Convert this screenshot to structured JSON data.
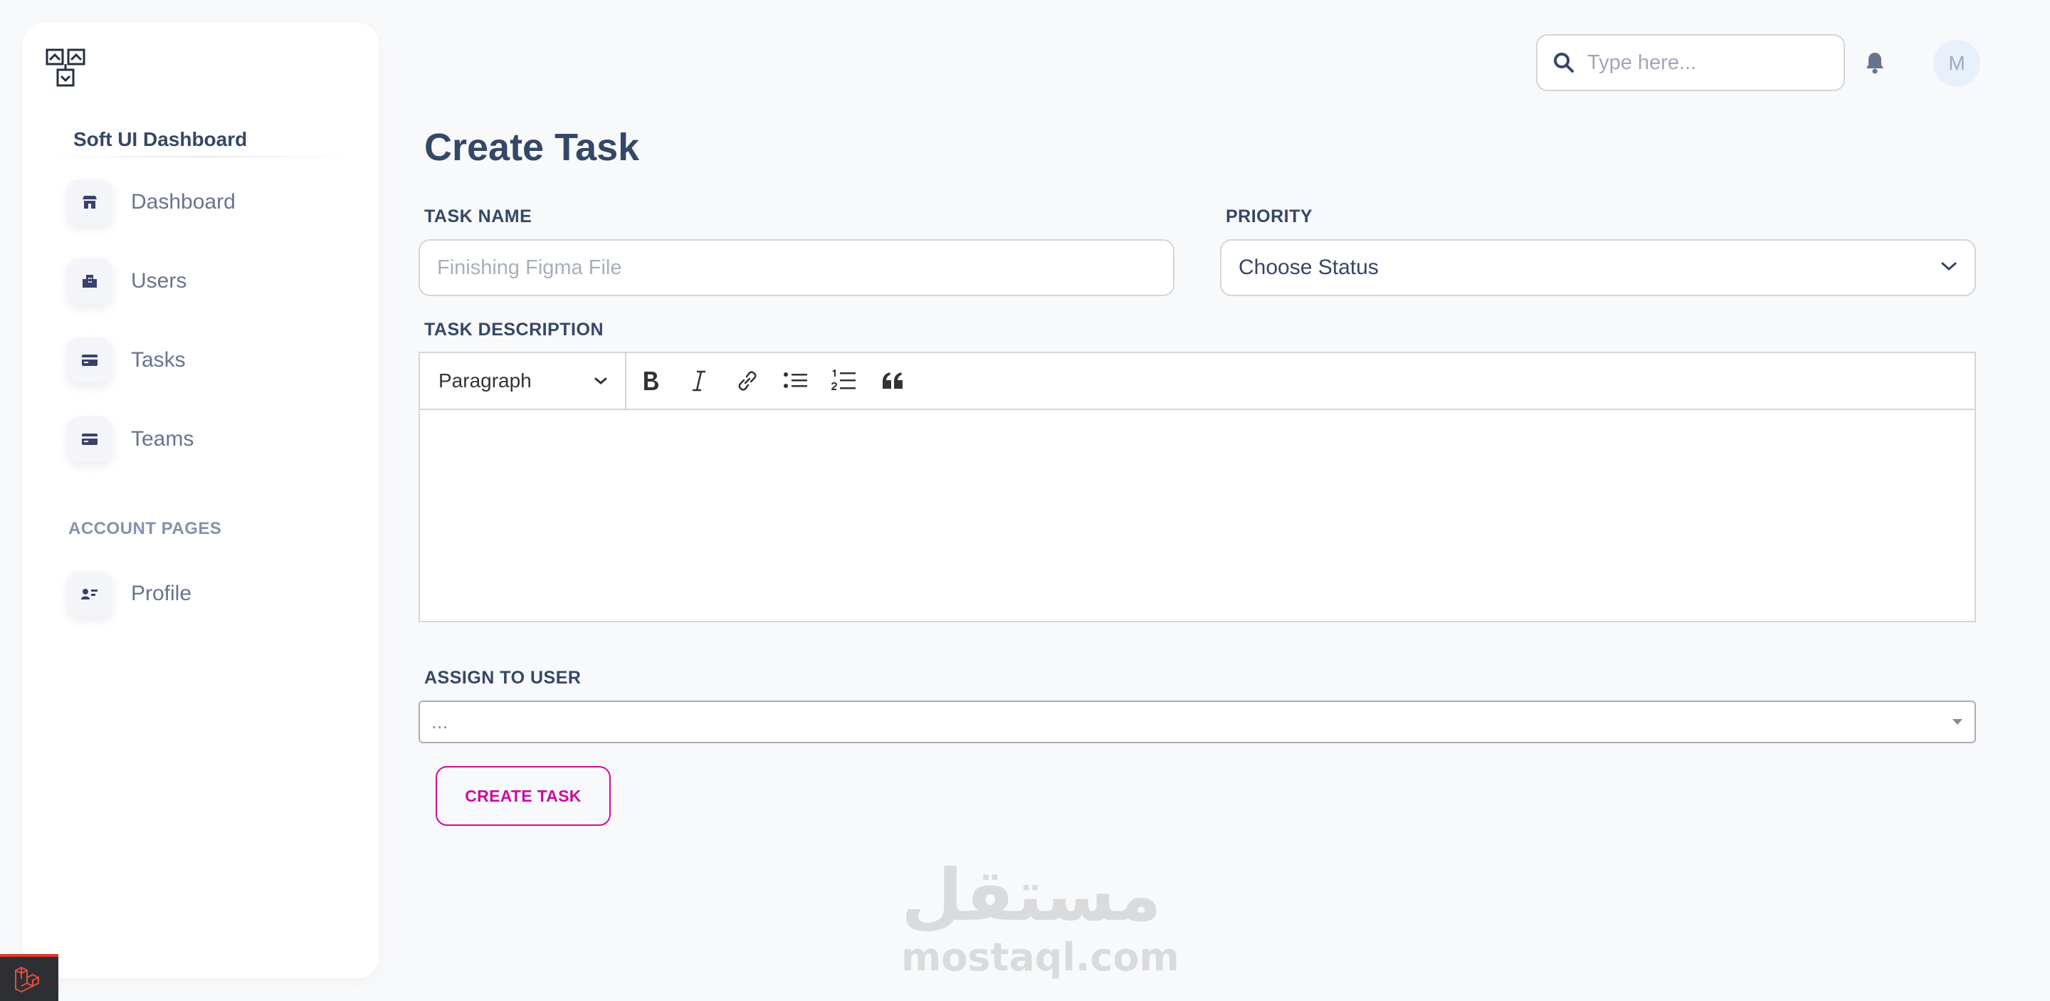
{
  "brand": {
    "name": "Soft UI Dashboard"
  },
  "sidebar": {
    "items": [
      {
        "label": "Dashboard",
        "icon": "shop-icon"
      },
      {
        "label": "Users",
        "icon": "office-icon"
      },
      {
        "label": "Tasks",
        "icon": "credit-card-icon"
      },
      {
        "label": "Teams",
        "icon": "credit-card-icon"
      }
    ],
    "section_title": "ACCOUNT PAGES",
    "account_items": [
      {
        "label": "Profile",
        "icon": "user-card-icon"
      }
    ]
  },
  "topbar": {
    "search_placeholder": "Type here...",
    "avatar_initial": "M"
  },
  "form": {
    "title": "Create Task",
    "task_name_label": "TASK NAME",
    "task_name_placeholder": "Finishing Figma File",
    "priority_label": "PRIORITY",
    "priority_value": "Choose Status",
    "description_label": "TASK DESCRIPTION",
    "editor_paragraph": "Paragraph",
    "assign_label": "ASSIGN TO USER",
    "assign_value": "...",
    "submit_label": "CREATE TASK"
  },
  "watermark": {
    "arabic": "مستقل",
    "latin": "mostaql.com"
  },
  "colors": {
    "accent": "#cb0c9f",
    "text": "#344767",
    "muted": "#67748e"
  }
}
